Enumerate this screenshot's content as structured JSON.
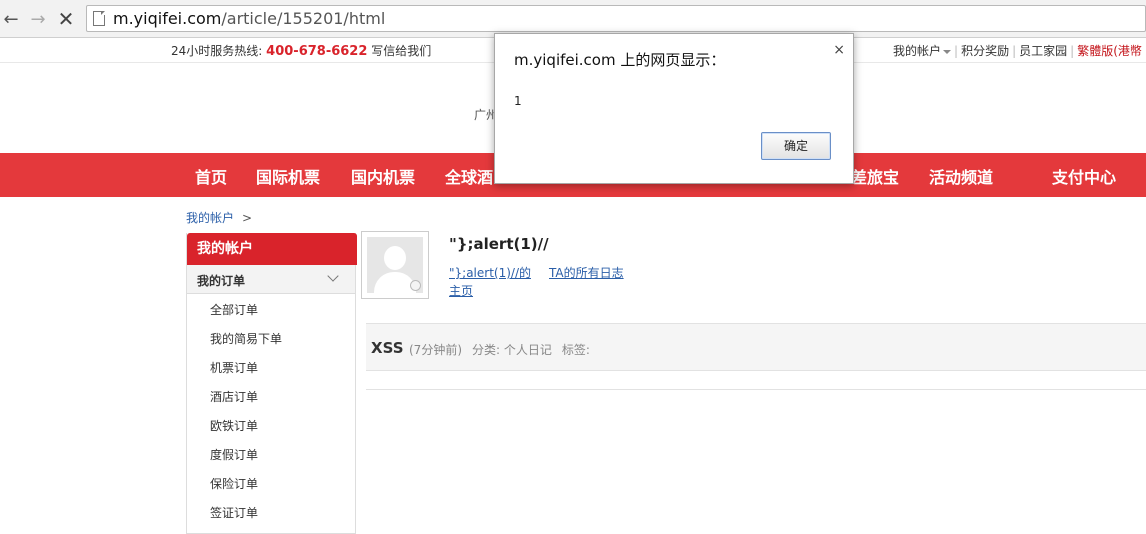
{
  "browser": {
    "url_host": "m.yiqifei.com",
    "url_path": "/article/155201/html"
  },
  "topbar": {
    "hotline_label": "24小时服务热线:",
    "hotline_number": "400-678-6622",
    "write_us": "写信给我们",
    "links": [
      "我的帐户",
      "积分奖励",
      "员工家园",
      "繁體版(港幣"
    ]
  },
  "header": {
    "partial_text": "广州"
  },
  "nav": {
    "items": [
      "首页",
      "国际机票",
      "国内机票",
      "全球酒",
      "差旅宝",
      "活动频道",
      "支付中心"
    ]
  },
  "breadcrumb": {
    "link": "我的帐户",
    "sep": ">"
  },
  "sidebar": {
    "title": "我的帐户",
    "section": "我的订单",
    "items": [
      "全部订单",
      "我的简易下单",
      "机票订单",
      "酒店订单",
      "欧铁订单",
      "度假订单",
      "保险订单",
      "签证订单"
    ]
  },
  "profile": {
    "name": "\"};alert(1)//",
    "home_link": "\"};alert(1)//的主页",
    "all_logs_link": "TA的所有日志"
  },
  "entry": {
    "title": "XSS",
    "time": "(7分钟前)",
    "category": "分类: 个人日记",
    "tags": "标签:"
  },
  "dialog": {
    "title": "m.yiqifei.com 上的网页显示：",
    "message": "1",
    "ok_label": "确定",
    "close": "×"
  },
  "colors": {
    "brand_red": "#e4393c",
    "sidebar_red": "#d9232b",
    "link_blue": "#2a5ea8"
  }
}
